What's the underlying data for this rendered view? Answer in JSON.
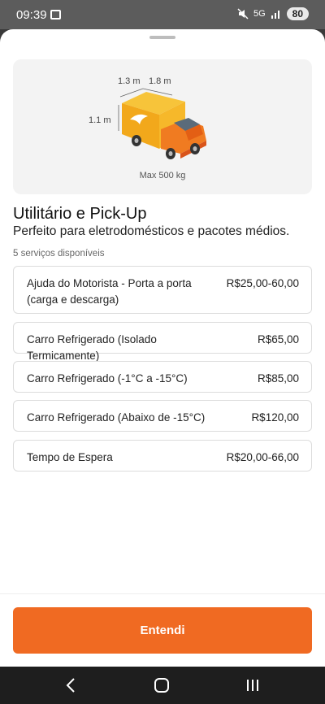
{
  "status_bar": {
    "time": "09:39",
    "signal": "5G",
    "battery": "80"
  },
  "vehicle": {
    "dim_length_1": "1.3 m",
    "dim_length_2": "1.8 m",
    "dim_height": "1.1 m",
    "max_load": "Max 500 kg",
    "truck_color": "#f07b21"
  },
  "sheet": {
    "title": "Utilitário e Pick-Up",
    "subtitle": "Perfeito para eletrodomésticos e pacotes médios.",
    "available": "5 serviços disponíveis"
  },
  "services": [
    {
      "name": "Ajuda do Motorista - Porta a porta (carga e descarga)",
      "price": "R$25,00-60,00"
    },
    {
      "name": "Carro Refrigerado (Isolado Termicamente)",
      "price": "R$65,00"
    },
    {
      "name": "Carro Refrigerado (-1°C a -15°C)",
      "price": "R$85,00"
    },
    {
      "name": "Carro Refrigerado (Abaixo de -15°C)",
      "price": "R$120,00"
    },
    {
      "name": "Tempo de Espera",
      "price": "R$20,00-66,00"
    }
  ],
  "footer": {
    "cta_label": "Entendi",
    "accent": "#f06a22"
  }
}
